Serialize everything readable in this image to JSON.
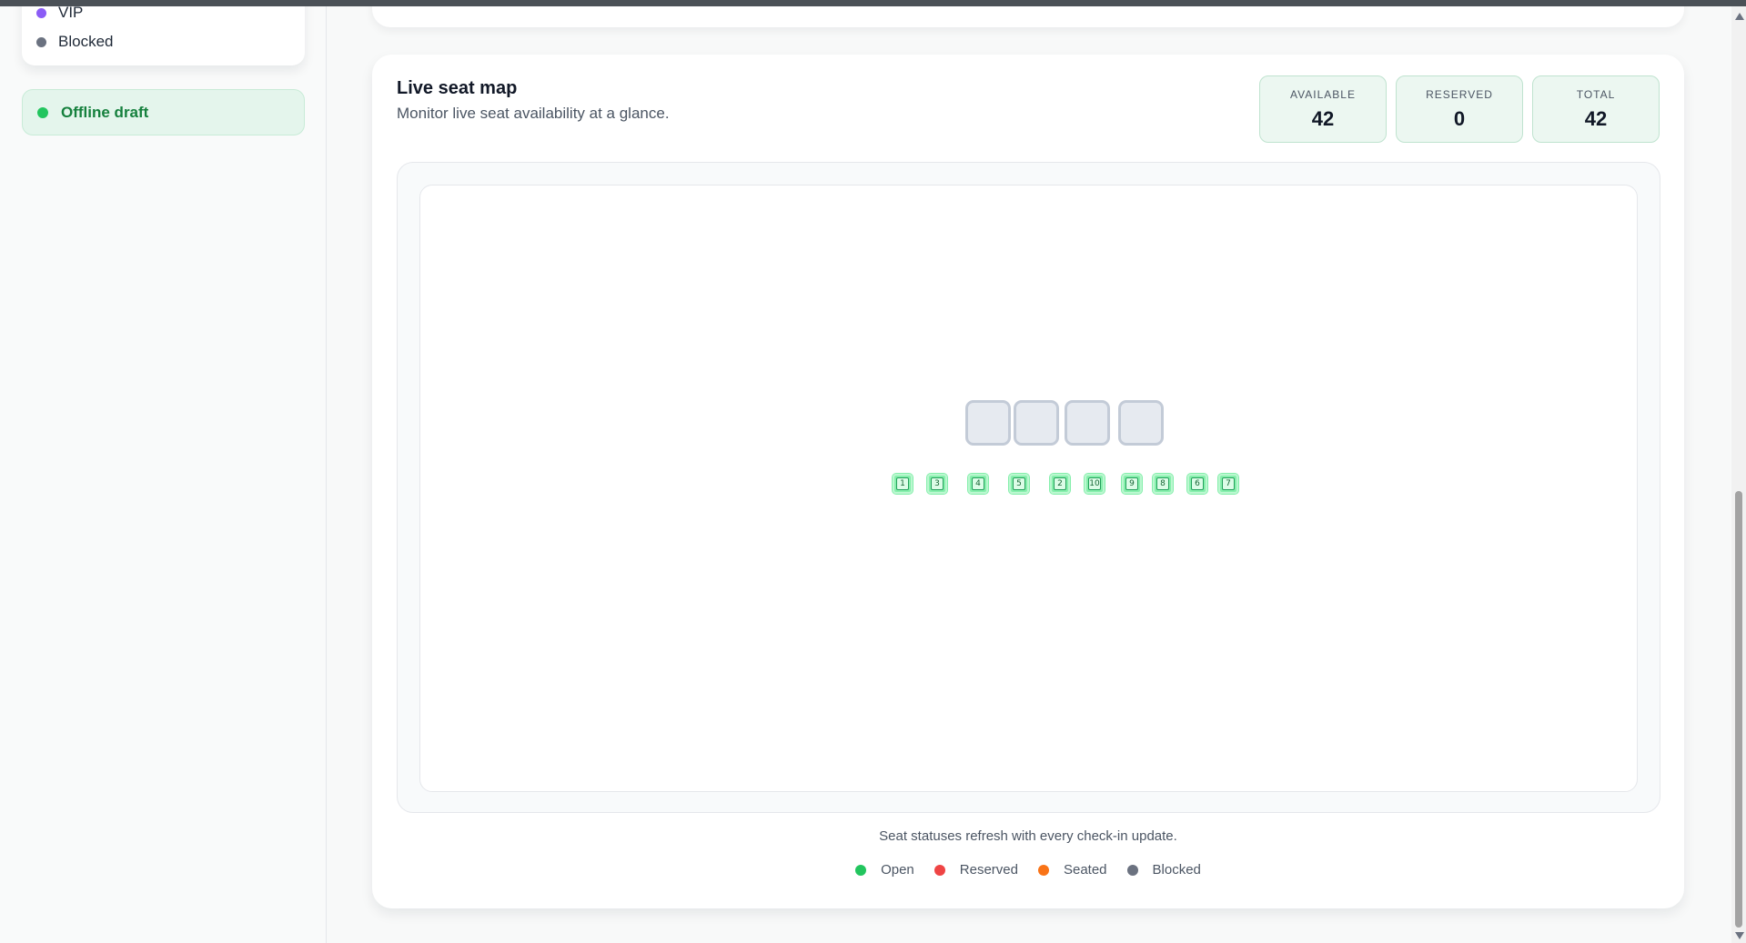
{
  "sidebar": {
    "legend": [
      {
        "label": "VIP",
        "color": "#8b5cf6"
      },
      {
        "label": "Blocked",
        "color": "#6b7280"
      }
    ],
    "status_pill": {
      "label": "Offline draft",
      "color": "#22c55e"
    }
  },
  "seat_map": {
    "title": "Live seat map",
    "subtitle": "Monitor live seat availability at a glance.",
    "stats": [
      {
        "label": "AVAILABLE",
        "value": "42"
      },
      {
        "label": "RESERVED",
        "value": "0"
      },
      {
        "label": "TOTAL",
        "value": "42"
      }
    ],
    "seats": [
      "1",
      "3",
      "4",
      "5",
      "2",
      "10",
      "9",
      "8",
      "6",
      "7"
    ],
    "refresh_note": "Seat statuses refresh with every check-in update.",
    "legend": [
      {
        "label": "Open",
        "color": "#22c55e"
      },
      {
        "label": "Reserved",
        "color": "#ef4444"
      },
      {
        "label": "Seated",
        "color": "#f97316"
      },
      {
        "label": "Blocked",
        "color": "#6b7280"
      }
    ]
  }
}
